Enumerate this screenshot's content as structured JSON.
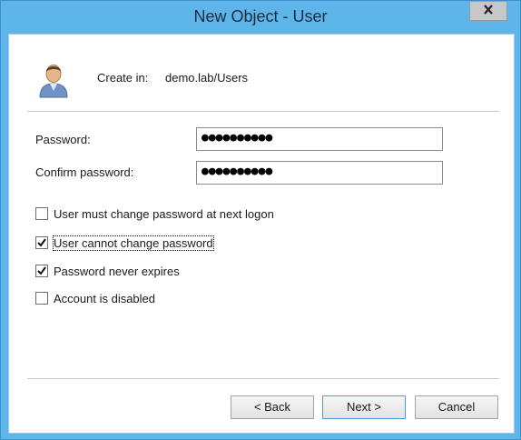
{
  "window": {
    "title": "New Object - User",
    "close_icon": "close-icon"
  },
  "header": {
    "icon": "user-icon",
    "create_in_label": "Create in:",
    "create_in_value": "demo.lab/Users"
  },
  "form": {
    "password_label": "Password:",
    "password_value": "●●●●●●●●●●",
    "confirm_label": "Confirm password:",
    "confirm_value": "●●●●●●●●●●"
  },
  "options": [
    {
      "label": "User must change password at next logon",
      "checked": false
    },
    {
      "label": "User cannot change password",
      "checked": true
    },
    {
      "label": "Password never expires",
      "checked": true
    },
    {
      "label": "Account is disabled",
      "checked": false
    }
  ],
  "buttons": {
    "back": "< Back",
    "next": "Next >",
    "cancel": "Cancel"
  },
  "colors": {
    "frame": "#5db5ea",
    "default_button_border": "#4a9fd8"
  }
}
